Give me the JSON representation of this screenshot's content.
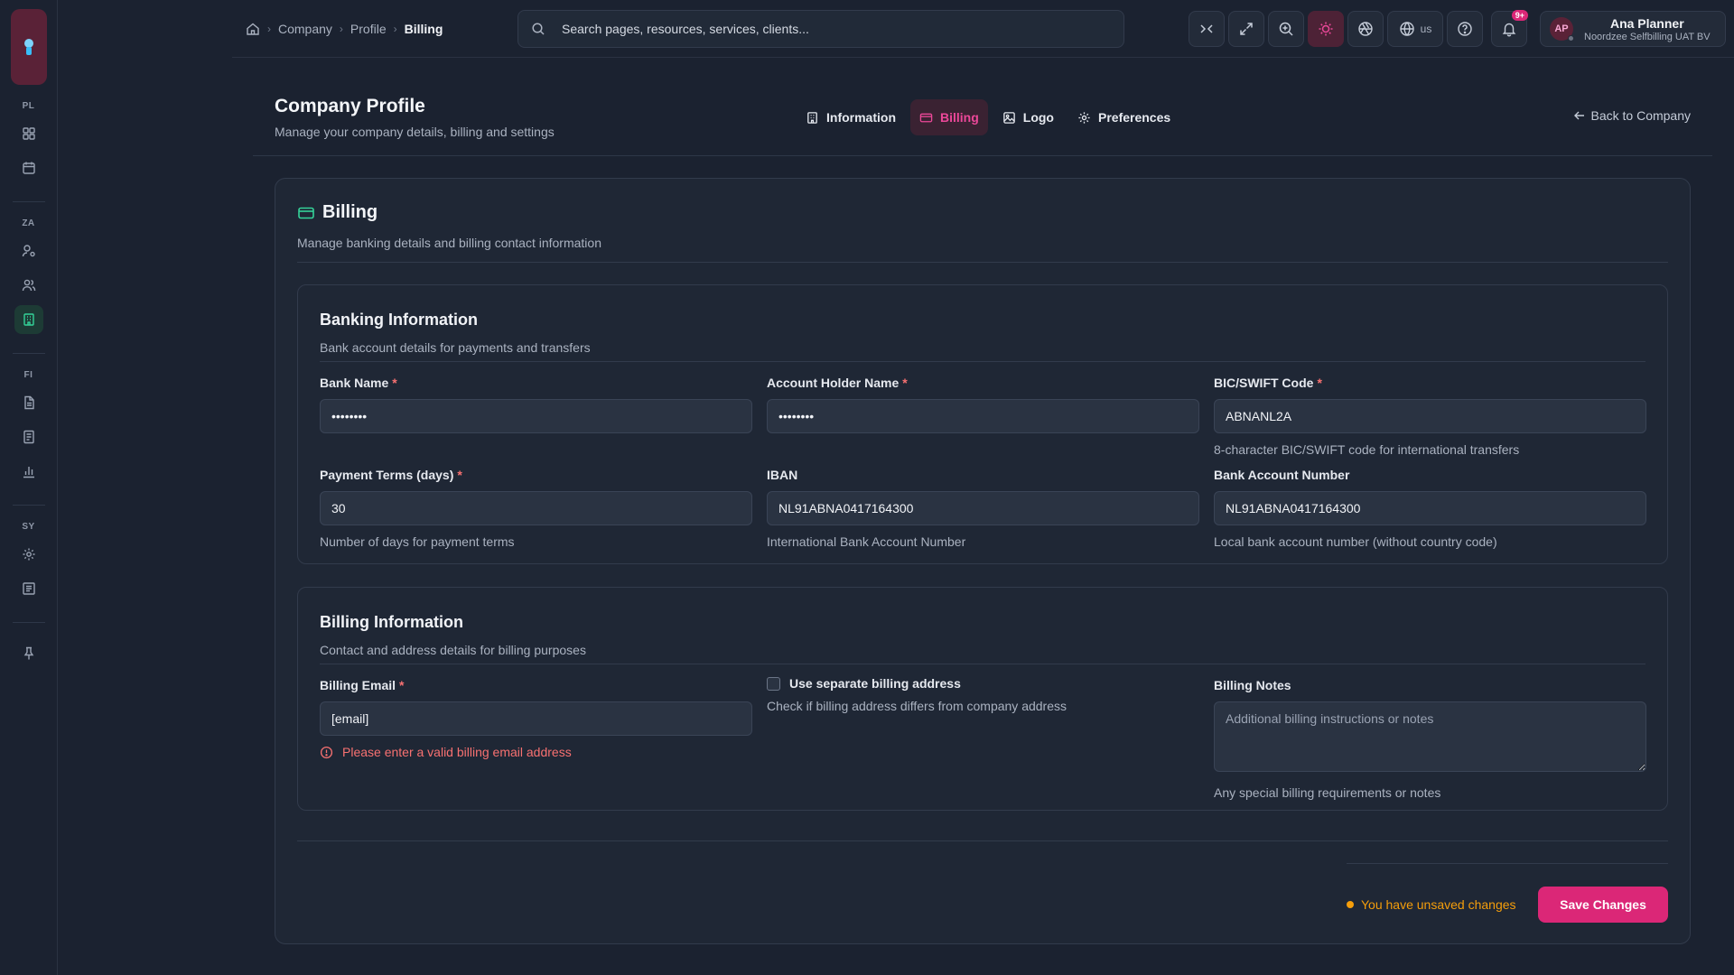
{
  "sidebar": {
    "sections": [
      {
        "label": "PL"
      },
      {
        "label": "ZA"
      },
      {
        "label": "FI"
      },
      {
        "label": "SY"
      }
    ]
  },
  "breadcrumb": {
    "items": [
      "Company",
      "Profile"
    ],
    "current": "Billing"
  },
  "search": {
    "placeholder": "Search pages, resources, services, clients..."
  },
  "toolbar": {
    "language": "us",
    "notification_count": "9+"
  },
  "user": {
    "initials": "AP",
    "name": "Ana Planner",
    "org": "Noordzee Selfbilling UAT BV"
  },
  "page": {
    "title": "Company Profile",
    "subtitle": "Manage your company details, billing and settings",
    "back_label": "Back to Company"
  },
  "tabs": [
    {
      "label": "Information",
      "icon": "building-icon"
    },
    {
      "label": "Billing",
      "icon": "credit-card-icon",
      "active": true
    },
    {
      "label": "Logo",
      "icon": "image-icon"
    },
    {
      "label": "Preferences",
      "icon": "gear-icon"
    }
  ],
  "billing": {
    "title": "Billing",
    "subtitle": "Manage banking details and billing contact information"
  },
  "banking": {
    "title": "Banking Information",
    "subtitle": "Bank account details for payments and transfers",
    "bank_name": {
      "label": "Bank Name",
      "value": "••••••••"
    },
    "holder_name": {
      "label": "Account Holder Name",
      "value": "••••••••"
    },
    "bic": {
      "label": "BIC/SWIFT Code",
      "value": "ABNANL2A",
      "hint": "8-character BIC/SWIFT code for international transfers"
    },
    "payment_terms": {
      "label": "Payment Terms (days)",
      "value": "30",
      "hint": "Number of days for payment terms"
    },
    "iban": {
      "label": "IBAN",
      "value": "NL91ABNA0417164300",
      "hint": "International Bank Account Number"
    },
    "account_number": {
      "label": "Bank Account Number",
      "value": "NL91ABNA0417164300",
      "hint": "Local bank account number (without country code)"
    }
  },
  "billing_info": {
    "title": "Billing Information",
    "subtitle": "Contact and address details for billing purposes",
    "email": {
      "label": "Billing Email",
      "value": "[email]",
      "error": "Please enter a valid billing email address"
    },
    "separate_address": {
      "label": "Use separate billing address",
      "hint": "Check if billing address differs from company address",
      "checked": false
    },
    "notes": {
      "label": "Billing Notes",
      "placeholder": "Additional billing instructions or notes",
      "hint": "Any special billing requirements or notes"
    }
  },
  "footer": {
    "unsaved": "You have unsaved changes",
    "save_label": "Save Changes"
  },
  "colors": {
    "accent": "#db2777",
    "success": "#34d399",
    "warning": "#f59e0b",
    "error": "#f87171",
    "background": "#1b2230"
  }
}
